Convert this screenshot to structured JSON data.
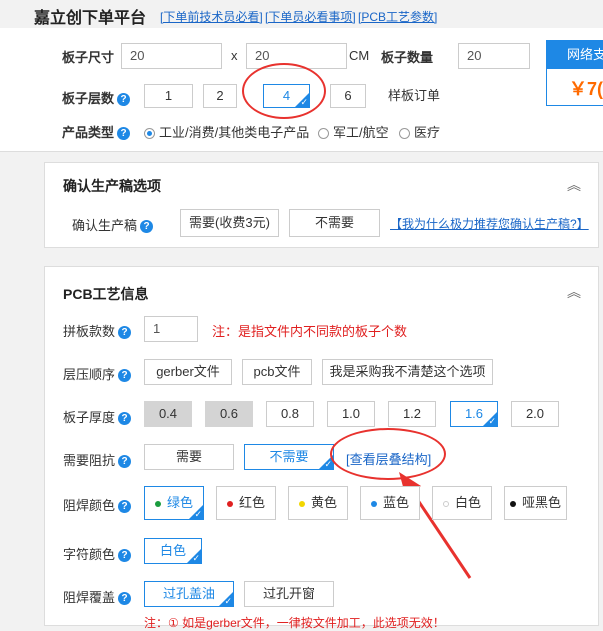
{
  "header": {
    "title": "嘉立创下单平台",
    "links": [
      "[下单前技术员必看]",
      "[下单员必看事项]",
      "[PCB工艺参数]"
    ]
  },
  "board": {
    "size_label": "板子尺寸",
    "width": "20",
    "x": "x",
    "height": "20",
    "unit": "CM",
    "qty_label": "板子数量",
    "qty": "20",
    "layers_label": "板子层数",
    "layers": [
      "1",
      "2",
      "4",
      "6"
    ],
    "layers_selected": "4",
    "sample_order": "样板订单",
    "type_label": "产品类型",
    "types": [
      "工业/消费/其他类电子产品",
      "军工/航空",
      "医疗"
    ]
  },
  "price": {
    "head": "网络支",
    "value": "￥7("
  },
  "confirm": {
    "title": "确认生产稿选项",
    "label": "确认生产稿",
    "need": "需要(收费3元)",
    "no_need": "不需要",
    "why_link": "【我为什么极力推荐您确认生产稿?】"
  },
  "pcb": {
    "title": "PCB工艺信息",
    "panel_label": "拼板款数",
    "panel_value": "1",
    "panel_note": "注：是指文件内不同款的板子个数",
    "stack_label": "层压顺序",
    "stack_opts": [
      "gerber文件",
      "pcb文件",
      "我是采购我不清楚这个选项"
    ],
    "thick_label": "板子厚度",
    "thick_opts": [
      "0.4",
      "0.6",
      "0.8",
      "1.0",
      "1.2",
      "1.6",
      "2.0"
    ],
    "imp_label": "需要阻抗",
    "imp_opts": [
      "需要",
      "不需要"
    ],
    "stackup_link": "[查看层叠结构]",
    "mask_label": "阻焊颜色",
    "mask_opts": [
      {
        "name": "绿色",
        "color": "#1a9c3e"
      },
      {
        "name": "红色",
        "color": "#e02020"
      },
      {
        "name": "黄色",
        "color": "#f2d600"
      },
      {
        "name": "蓝色",
        "color": "#1e88e5"
      },
      {
        "name": "白色",
        "color": "#ffffff"
      },
      {
        "name": "哑黑色",
        "color": "#111111"
      }
    ],
    "silk_label": "字符颜色",
    "silk_opt": "白色",
    "cover_label": "阻焊覆盖",
    "cover_opts": [
      "过孔盖油",
      "过孔开窗"
    ],
    "cover_note": "注：① 如是gerber文件，一律按文件加工，此选项无效！"
  },
  "colors": {
    "accent": "#1e88e5",
    "annotation": "#e8322e",
    "price": "#ff6a00"
  }
}
